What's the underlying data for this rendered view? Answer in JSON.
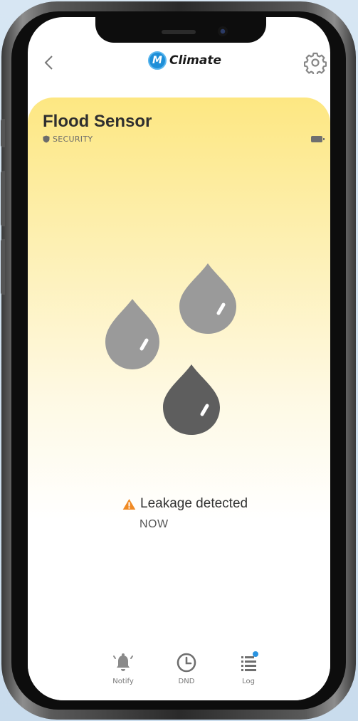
{
  "app": {
    "brand_logo_letter": "M",
    "brand_name": "Climate"
  },
  "device": {
    "name": "Flood Sensor",
    "category": "SECURITY",
    "battery_icon": "battery-icon"
  },
  "status": {
    "message": "Leakage detected",
    "time": "NOW",
    "alert_color": "#f08a24"
  },
  "illustration": {
    "icon": "water-drops-icon",
    "drop_light_color": "#9a9a9a",
    "drop_dark_color": "#5e5e5e"
  },
  "card": {
    "gradient_top_color": "#fde782",
    "gradient_bottom_color": "#ffffff"
  },
  "nav": {
    "items": [
      {
        "label": "Notify",
        "icon": "bell-icon"
      },
      {
        "label": "DND",
        "icon": "clock-icon"
      },
      {
        "label": "Log",
        "icon": "list-icon"
      }
    ],
    "badge_color": "#2a93e0"
  }
}
